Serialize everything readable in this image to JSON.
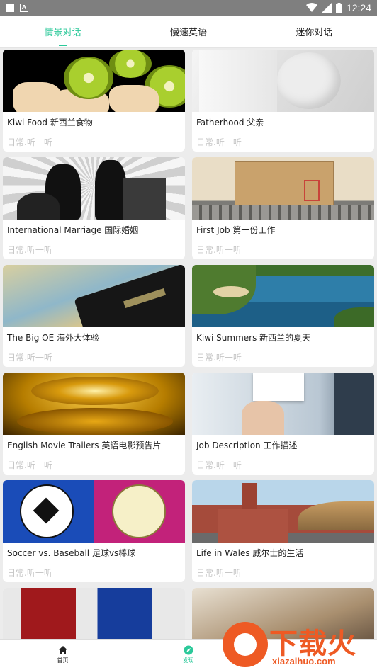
{
  "status_bar": {
    "time": "12:24"
  },
  "tabs": [
    {
      "label": "情景对话",
      "active": true
    },
    {
      "label": "慢速英语",
      "active": false
    },
    {
      "label": "迷你对话",
      "active": false
    }
  ],
  "cards": [
    {
      "title": "Kiwi Food 新西兰食物",
      "subtitle": "日常.听一听"
    },
    {
      "title": "Fatherhood 父亲",
      "subtitle": "日常.听一听"
    },
    {
      "title": "International Marriage 国际婚姻",
      "subtitle": "日常.听一听"
    },
    {
      "title": "First Job 第一份工作",
      "subtitle": "日常.听一听"
    },
    {
      "title": "The Big OE 海外大体验",
      "subtitle": "日常.听一听"
    },
    {
      "title": "Kiwi Summers 新西兰的夏天",
      "subtitle": "日常.听一听"
    },
    {
      "title": "English Movie Trailers 英语电影预告片",
      "subtitle": "日常.听一听"
    },
    {
      "title": "Job Description 工作描述",
      "subtitle": "日常.听一听"
    },
    {
      "title": "Soccer vs. Baseball 足球vs棒球",
      "subtitle": "日常.听一听"
    },
    {
      "title": "Life in Wales 威尔士的生活",
      "subtitle": "日常.听一听"
    }
  ],
  "bottom_nav": {
    "home_label": "首页",
    "discover_label": "发现"
  },
  "watermark": {
    "text": "下载火",
    "url": "xiazaihuo.com"
  },
  "colors": {
    "accent": "#2cc99a",
    "watermark": "#ee5a24"
  }
}
